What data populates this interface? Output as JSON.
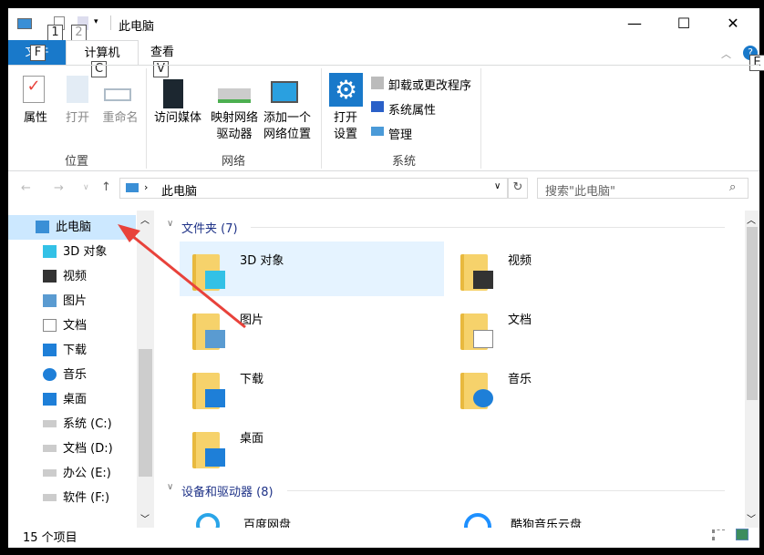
{
  "window": {
    "title": "此电脑",
    "quick_access_keys": [
      "1",
      "2"
    ],
    "minimize": "—",
    "maximize": "☐",
    "close": "✕",
    "help": "?",
    "help_key": "E"
  },
  "ribbon": {
    "tabs": [
      {
        "label": "文件",
        "key": "F"
      },
      {
        "label": "计算机",
        "key": "C",
        "active": true
      },
      {
        "label": "查看",
        "key": "V"
      }
    ],
    "groups": [
      {
        "label": "位置",
        "buttons": [
          "属性",
          "打开",
          "重命名"
        ]
      },
      {
        "label": "网络",
        "buttons": [
          "访问媒体",
          "映射网络\n驱动器",
          "添加一个\n网络位置"
        ]
      },
      {
        "label": "系统",
        "buttons": [
          "打开\n设置"
        ],
        "small_buttons": [
          "卸载或更改程序",
          "系统属性",
          "管理"
        ]
      }
    ]
  },
  "address": {
    "path": "此电脑",
    "search_placeholder": "搜索\"此电脑\""
  },
  "nav": {
    "items": [
      {
        "label": "此电脑",
        "icon": "computer-icon",
        "selected": true
      },
      {
        "label": "3D 对象",
        "icon": "cube-icon"
      },
      {
        "label": "视频",
        "icon": "video-icon"
      },
      {
        "label": "图片",
        "icon": "picture-icon"
      },
      {
        "label": "文档",
        "icon": "document-icon"
      },
      {
        "label": "下载",
        "icon": "download-icon"
      },
      {
        "label": "音乐",
        "icon": "music-icon"
      },
      {
        "label": "桌面",
        "icon": "desktop-icon"
      },
      {
        "label": "系统 (C:)",
        "icon": "drive-icon"
      },
      {
        "label": "文档 (D:)",
        "icon": "drive-icon"
      },
      {
        "label": "办公 (E:)",
        "icon": "drive-icon"
      },
      {
        "label": "软件 (F:)",
        "icon": "drive-icon"
      }
    ]
  },
  "content": {
    "folders_header": "文件夹 (7)",
    "folders": [
      {
        "label": "3D 对象",
        "icon": "cube-icon",
        "selected": true
      },
      {
        "label": "视频",
        "icon": "video-icon"
      },
      {
        "label": "图片",
        "icon": "picture-icon"
      },
      {
        "label": "文档",
        "icon": "document-icon"
      },
      {
        "label": "下载",
        "icon": "download-icon"
      },
      {
        "label": "音乐",
        "icon": "music-icon"
      },
      {
        "label": "桌面",
        "icon": "desktop-icon"
      }
    ],
    "devices_header": "设备和驱动器 (8)",
    "devices": [
      {
        "label": "百度网盘"
      },
      {
        "label": "酷狗音乐云盘"
      }
    ]
  },
  "status": {
    "count": "15 个项目"
  },
  "colors": {
    "accent": "#1979ca",
    "selection": "#e5f3ff",
    "file_tab": "#1979ca",
    "arrow": "#e8423b"
  }
}
